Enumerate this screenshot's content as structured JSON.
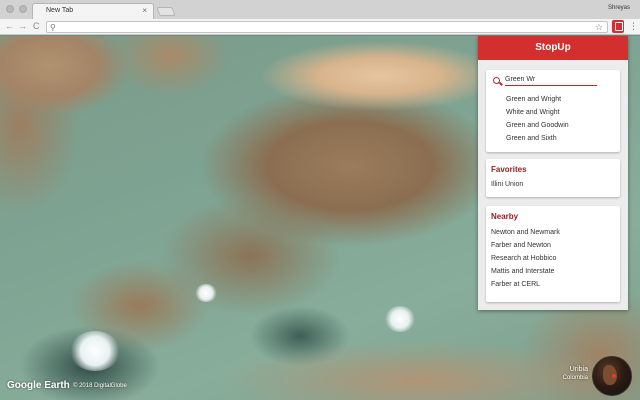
{
  "browser": {
    "tab_title": "New Tab",
    "tab_close": "×",
    "profile_name": "Shreyas",
    "nav_back": "←",
    "nav_forward": "→",
    "nav_reload": "C",
    "omnibox_value": "",
    "omnibox_icon": "search-icon",
    "star": "☆",
    "menu": "⋮"
  },
  "earth": {
    "logo": "Google Earth",
    "copyright": "© 2018 DigitalGlobe",
    "place_name": "Uribia",
    "place_country": "Colombia"
  },
  "panel": {
    "title": "StopUp",
    "accent_color": "#d32f2f",
    "search": {
      "value": "Green Wr",
      "suggestions": [
        "Green and Wright",
        "White and Wright",
        "Green and Goodwin",
        "Green and Sixth"
      ]
    },
    "favorites": {
      "title": "Favorites",
      "items": [
        "Illini Union"
      ]
    },
    "nearby": {
      "title": "Nearby",
      "items": [
        "Newton and Newmark",
        "Farber and Newton",
        "Research at Hobbico",
        "Mattis and Interstate",
        "Farber at CERL"
      ]
    }
  }
}
